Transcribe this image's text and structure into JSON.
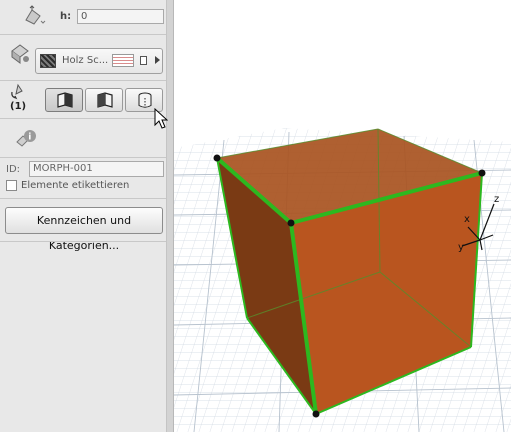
{
  "panel": {
    "height": {
      "label": "h:",
      "value": "0"
    },
    "surface": {
      "material": "Holz Sc..."
    },
    "paint": {
      "count": "(1)"
    },
    "id": {
      "label": "ID:",
      "value": "MORPH-001"
    },
    "label_elements": "Elemente etikettieren",
    "categories_button": "Kennzeichen und Kategorien..."
  },
  "viewport": {
    "axes": {
      "x": "x",
      "y": "y",
      "z": "z"
    }
  },
  "colors": {
    "cube_face": "#b4531e",
    "cube_edge": "#2db81f",
    "panel_bg": "#e8e8e8"
  }
}
